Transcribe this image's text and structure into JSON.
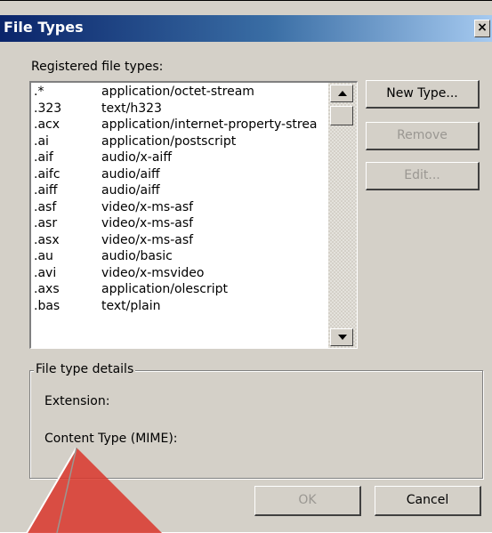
{
  "window": {
    "title": "File Types",
    "close_glyph": "×"
  },
  "list": {
    "label": "Registered file types:",
    "rows": [
      {
        "ext": ".*",
        "mime": "application/octet-stream"
      },
      {
        "ext": ".323",
        "mime": "text/h323"
      },
      {
        "ext": ".acx",
        "mime": "application/internet-property-strea"
      },
      {
        "ext": ".ai",
        "mime": "application/postscript"
      },
      {
        "ext": ".aif",
        "mime": "audio/x-aiff"
      },
      {
        "ext": ".aifc",
        "mime": "audio/aiff"
      },
      {
        "ext": ".aiff",
        "mime": "audio/aiff"
      },
      {
        "ext": ".asf",
        "mime": "video/x-ms-asf"
      },
      {
        "ext": ".asr",
        "mime": "video/x-ms-asf"
      },
      {
        "ext": ".asx",
        "mime": "video/x-ms-asf"
      },
      {
        "ext": ".au",
        "mime": "audio/basic"
      },
      {
        "ext": ".avi",
        "mime": "video/x-msvideo"
      },
      {
        "ext": ".axs",
        "mime": "application/olescript"
      },
      {
        "ext": ".bas",
        "mime": "text/plain"
      }
    ]
  },
  "buttons": {
    "new_type": "New Type...",
    "remove": "Remove",
    "edit": "Edit...",
    "ok": "OK",
    "cancel": "Cancel"
  },
  "details": {
    "caption": "File type details",
    "extension_label": "Extension:",
    "content_type_label": "Content Type (MIME):"
  },
  "colors": {
    "dialog_face": "#d4d0c8",
    "titlebar_start": "#0a246a",
    "titlebar_end": "#a6caf0",
    "disabled_text": "#9a9792",
    "watermark_red": "#d9362c"
  }
}
